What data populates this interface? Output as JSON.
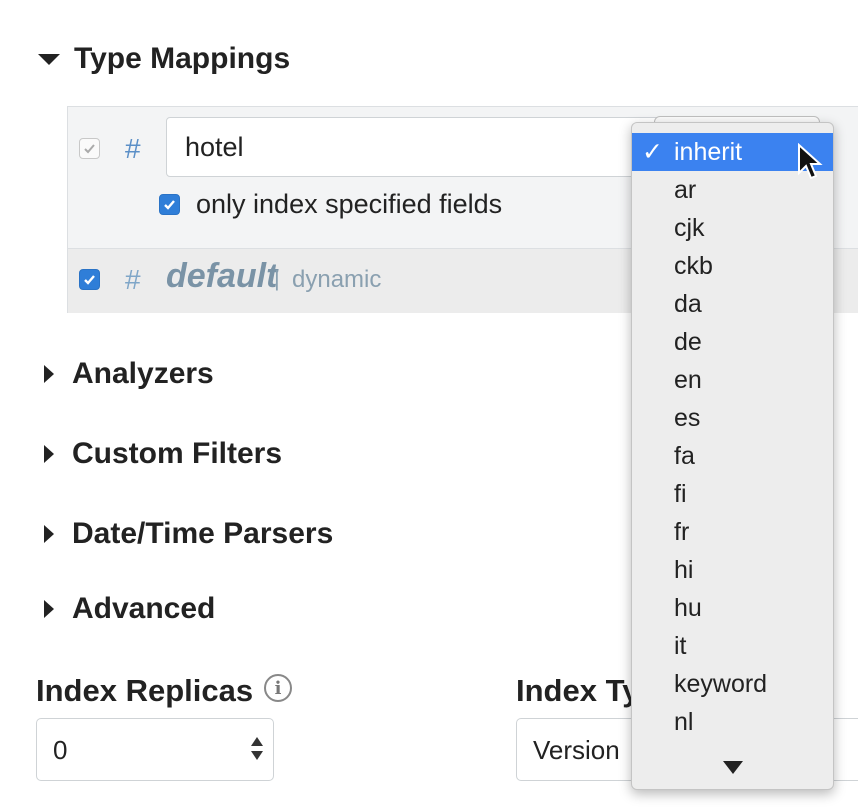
{
  "sections": {
    "type_mappings": "Type Mappings",
    "analyzers": "Analyzers",
    "custom_filters": "Custom Filters",
    "datetime_parsers": "Date/Time Parsers",
    "advanced": "Advanced"
  },
  "mapping": {
    "hash_symbol": "#",
    "type_name_value": "hotel",
    "only_index_label": "only index specified fields",
    "default_name": "default",
    "separator": "|",
    "default_mode": "dynamic"
  },
  "fields": {
    "index_replicas_label": "Index Replicas",
    "index_replicas_value": "0",
    "index_type_label": "Index Ty",
    "index_type_value": "Version"
  },
  "analyzer_dropdown": {
    "check_mark": "✓",
    "items": [
      "inherit",
      "ar",
      "cjk",
      "ckb",
      "da",
      "de",
      "en",
      "es",
      "fa",
      "fi",
      "fr",
      "hi",
      "hu",
      "it",
      "keyword",
      "nl"
    ],
    "selected": "inherit"
  },
  "colors": {
    "accent": "#2f7ed8",
    "selected_item": "#3b82f0",
    "hash": "#5b8fc7"
  },
  "icons": {
    "section_expanded": "triangle-down-icon",
    "section_collapsed": "triangle-right-icon",
    "info": "info-icon",
    "more_below": "triangle-down-icon"
  }
}
